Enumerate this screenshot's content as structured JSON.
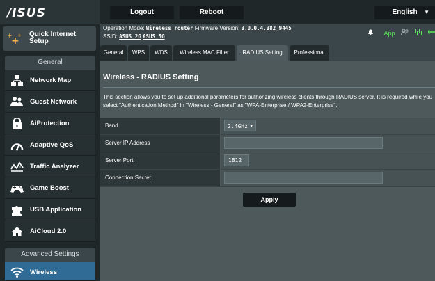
{
  "brand": {
    "logo": "/ISUS"
  },
  "topbar": {
    "logout_label": "Logout",
    "reboot_label": "Reboot",
    "language_label": "English"
  },
  "status": {
    "op_mode_label": "Operation Mode:",
    "op_mode_value": "Wireless router",
    "firmware_label": "Firmware Version:",
    "firmware_value": "3.0.0.4.382_9445",
    "ssid_label": "SSID:",
    "ssid_values": [
      "ASUS_2G",
      "ASUS_5G"
    ],
    "app_label": "App",
    "icons": [
      "bell-icon",
      "app-icon",
      "users-icon",
      "copy-icon",
      "usb-icon"
    ]
  },
  "sidebar": {
    "qis_label": "Quick Internet Setup",
    "general_heading": "General",
    "items": [
      {
        "label": "Network Map",
        "icon": "network-map-icon"
      },
      {
        "label": "Guest Network",
        "icon": "guest-network-icon"
      },
      {
        "label": "AiProtection",
        "icon": "lock-icon"
      },
      {
        "label": "Adaptive QoS",
        "icon": "gauge-icon"
      },
      {
        "label": "Traffic Analyzer",
        "icon": "traffic-chart-icon"
      },
      {
        "label": "Game Boost",
        "icon": "gamepad-icon"
      },
      {
        "label": "USB Application",
        "icon": "puzzle-icon"
      },
      {
        "label": "AiCloud 2.0",
        "icon": "cloud-house-icon"
      }
    ],
    "advanced_heading": "Advanced Settings",
    "advanced_items": [
      {
        "label": "Wireless",
        "icon": "wifi-icon",
        "active": true
      }
    ]
  },
  "tabs": [
    {
      "label": "General"
    },
    {
      "label": "WPS"
    },
    {
      "label": "WDS"
    },
    {
      "label": "Wireless MAC Filter"
    },
    {
      "label": "RADIUS Setting",
      "active": true
    },
    {
      "label": "Professional"
    }
  ],
  "main": {
    "title": "Wireless - RADIUS Setting",
    "description": "This section allows you to set up additional parameters for authorizing wireless clients through RADIUS server. It is required while you select \"Authentication Method\" in \"Wireless - General\" as \"WPA-Enterprise / WPA2-Enterprise\".",
    "fields": {
      "band": {
        "label": "Band",
        "value": "2.4GHz"
      },
      "server_ip": {
        "label": "Server IP Address",
        "value": ""
      },
      "server_port": {
        "label": "Server Port:",
        "value": "1812"
      },
      "secret": {
        "label": "Connection Secret",
        "value": ""
      }
    },
    "apply_label": "Apply"
  },
  "colors": {
    "sidebar_bg": "#1f2729",
    "panel_bg": "#4d595b",
    "active_blue": "#2f6b94",
    "status_green": "#5ce25c",
    "qis_icon": "#f6b84d"
  }
}
